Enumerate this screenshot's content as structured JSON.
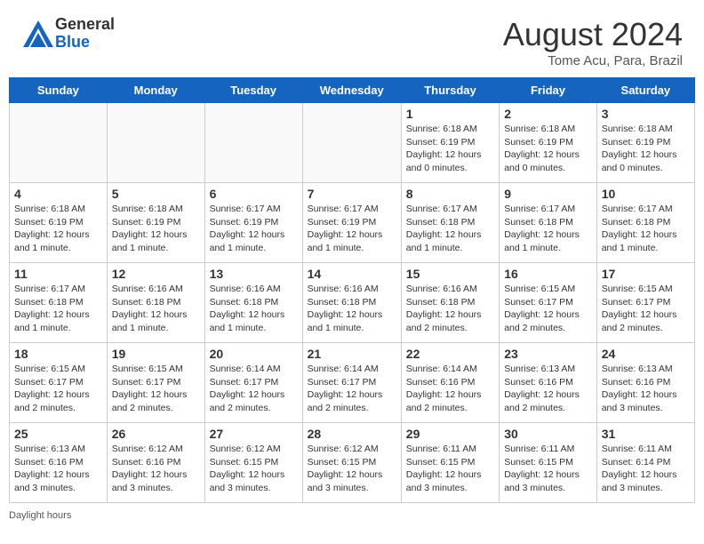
{
  "header": {
    "logo_general": "General",
    "logo_blue": "Blue",
    "month_year": "August 2024",
    "location": "Tome Acu, Para, Brazil"
  },
  "days": [
    "Sunday",
    "Monday",
    "Tuesday",
    "Wednesday",
    "Thursday",
    "Friday",
    "Saturday"
  ],
  "weeks": [
    [
      {
        "date": "",
        "info": ""
      },
      {
        "date": "",
        "info": ""
      },
      {
        "date": "",
        "info": ""
      },
      {
        "date": "",
        "info": ""
      },
      {
        "date": "1",
        "info": "Sunrise: 6:18 AM\nSunset: 6:19 PM\nDaylight: 12 hours and 0 minutes."
      },
      {
        "date": "2",
        "info": "Sunrise: 6:18 AM\nSunset: 6:19 PM\nDaylight: 12 hours and 0 minutes."
      },
      {
        "date": "3",
        "info": "Sunrise: 6:18 AM\nSunset: 6:19 PM\nDaylight: 12 hours and 0 minutes."
      }
    ],
    [
      {
        "date": "4",
        "info": "Sunrise: 6:18 AM\nSunset: 6:19 PM\nDaylight: 12 hours and 1 minute."
      },
      {
        "date": "5",
        "info": "Sunrise: 6:18 AM\nSunset: 6:19 PM\nDaylight: 12 hours and 1 minute."
      },
      {
        "date": "6",
        "info": "Sunrise: 6:17 AM\nSunset: 6:19 PM\nDaylight: 12 hours and 1 minute."
      },
      {
        "date": "7",
        "info": "Sunrise: 6:17 AM\nSunset: 6:19 PM\nDaylight: 12 hours and 1 minute."
      },
      {
        "date": "8",
        "info": "Sunrise: 6:17 AM\nSunset: 6:18 PM\nDaylight: 12 hours and 1 minute."
      },
      {
        "date": "9",
        "info": "Sunrise: 6:17 AM\nSunset: 6:18 PM\nDaylight: 12 hours and 1 minute."
      },
      {
        "date": "10",
        "info": "Sunrise: 6:17 AM\nSunset: 6:18 PM\nDaylight: 12 hours and 1 minute."
      }
    ],
    [
      {
        "date": "11",
        "info": "Sunrise: 6:17 AM\nSunset: 6:18 PM\nDaylight: 12 hours and 1 minute."
      },
      {
        "date": "12",
        "info": "Sunrise: 6:16 AM\nSunset: 6:18 PM\nDaylight: 12 hours and 1 minute."
      },
      {
        "date": "13",
        "info": "Sunrise: 6:16 AM\nSunset: 6:18 PM\nDaylight: 12 hours and 1 minute."
      },
      {
        "date": "14",
        "info": "Sunrise: 6:16 AM\nSunset: 6:18 PM\nDaylight: 12 hours and 1 minute."
      },
      {
        "date": "15",
        "info": "Sunrise: 6:16 AM\nSunset: 6:18 PM\nDaylight: 12 hours and 2 minutes."
      },
      {
        "date": "16",
        "info": "Sunrise: 6:15 AM\nSunset: 6:17 PM\nDaylight: 12 hours and 2 minutes."
      },
      {
        "date": "17",
        "info": "Sunrise: 6:15 AM\nSunset: 6:17 PM\nDaylight: 12 hours and 2 minutes."
      }
    ],
    [
      {
        "date": "18",
        "info": "Sunrise: 6:15 AM\nSunset: 6:17 PM\nDaylight: 12 hours and 2 minutes."
      },
      {
        "date": "19",
        "info": "Sunrise: 6:15 AM\nSunset: 6:17 PM\nDaylight: 12 hours and 2 minutes."
      },
      {
        "date": "20",
        "info": "Sunrise: 6:14 AM\nSunset: 6:17 PM\nDaylight: 12 hours and 2 minutes."
      },
      {
        "date": "21",
        "info": "Sunrise: 6:14 AM\nSunset: 6:17 PM\nDaylight: 12 hours and 2 minutes."
      },
      {
        "date": "22",
        "info": "Sunrise: 6:14 AM\nSunset: 6:16 PM\nDaylight: 12 hours and 2 minutes."
      },
      {
        "date": "23",
        "info": "Sunrise: 6:13 AM\nSunset: 6:16 PM\nDaylight: 12 hours and 2 minutes."
      },
      {
        "date": "24",
        "info": "Sunrise: 6:13 AM\nSunset: 6:16 PM\nDaylight: 12 hours and 3 minutes."
      }
    ],
    [
      {
        "date": "25",
        "info": "Sunrise: 6:13 AM\nSunset: 6:16 PM\nDaylight: 12 hours and 3 minutes."
      },
      {
        "date": "26",
        "info": "Sunrise: 6:12 AM\nSunset: 6:16 PM\nDaylight: 12 hours and 3 minutes."
      },
      {
        "date": "27",
        "info": "Sunrise: 6:12 AM\nSunset: 6:15 PM\nDaylight: 12 hours and 3 minutes."
      },
      {
        "date": "28",
        "info": "Sunrise: 6:12 AM\nSunset: 6:15 PM\nDaylight: 12 hours and 3 minutes."
      },
      {
        "date": "29",
        "info": "Sunrise: 6:11 AM\nSunset: 6:15 PM\nDaylight: 12 hours and 3 minutes."
      },
      {
        "date": "30",
        "info": "Sunrise: 6:11 AM\nSunset: 6:15 PM\nDaylight: 12 hours and 3 minutes."
      },
      {
        "date": "31",
        "info": "Sunrise: 6:11 AM\nSunset: 6:14 PM\nDaylight: 12 hours and 3 minutes."
      }
    ]
  ],
  "footer": {
    "daylight_label": "Daylight hours"
  }
}
